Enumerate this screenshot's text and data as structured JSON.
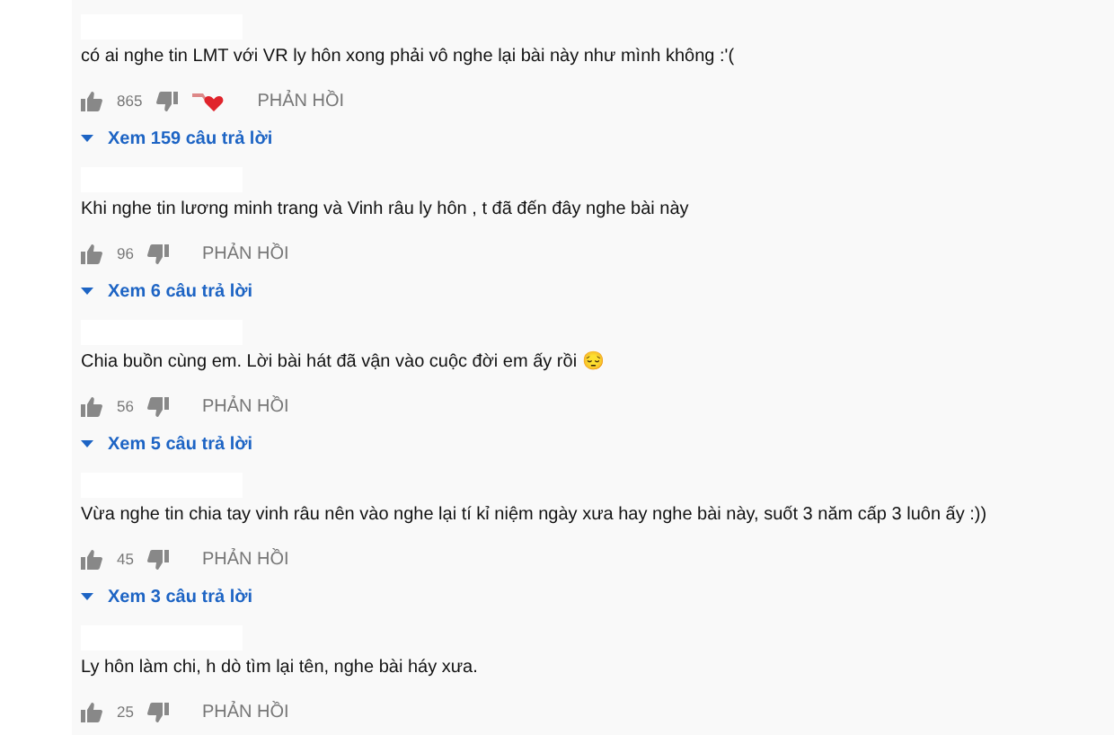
{
  "comments": [
    {
      "text": "có ai nghe tin LMT với VR ly hôn xong phải vô nghe lại bài này như mình không :'(",
      "likes": "865",
      "hearted": true,
      "reply_label": "PHẢN HỒI",
      "replies": "Xem 159 câu trả lời"
    },
    {
      "text": "Khi nghe tin lương minh trang và Vinh râu ly hôn , t đã đến đây nghe bài này",
      "likes": "96",
      "hearted": false,
      "reply_label": "PHẢN HỒI",
      "replies": "Xem 6 câu trả lời"
    },
    {
      "text": "Chia buồn cùng em. Lời bài hát đã vận vào cuộc đời em ấy rồi 😔",
      "likes": "56",
      "hearted": false,
      "reply_label": "PHẢN HỒI",
      "replies": "Xem 5 câu trả lời"
    },
    {
      "text": "Vừa nghe tin chia tay vinh râu nên vào nghe lại tí kỉ niệm ngày xưa hay nghe bài này, suốt 3 năm cấp 3 luôn ấy :))",
      "likes": "45",
      "hearted": false,
      "reply_label": "PHẢN HỒI",
      "replies": "Xem 3 câu trả lời"
    },
    {
      "text": "Ly hôn làm chi, h dò tìm lại tên, nghe bài háy xưa.",
      "likes": "25",
      "hearted": false,
      "reply_label": "PHẢN HỒI"
    }
  ]
}
